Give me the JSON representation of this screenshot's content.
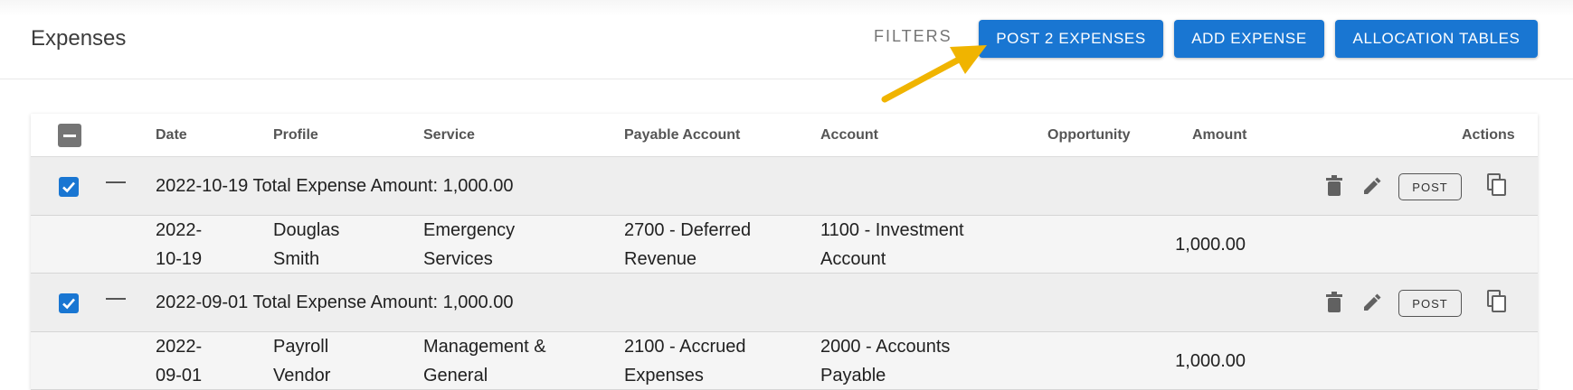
{
  "header": {
    "title": "Expenses",
    "filters_label": "FILTERS",
    "post_button": "POST 2 EXPENSES",
    "add_button": "ADD EXPENSE",
    "allocation_button": "ALLOCATION TABLES"
  },
  "table": {
    "columns": [
      "Date",
      "Profile",
      "Service",
      "Payable Account",
      "Account",
      "Opportunity",
      "Amount",
      "Actions"
    ],
    "groups": [
      {
        "summary": "2022-10-19 Total Expense Amount: 1,000.00",
        "checked": true,
        "post_label": "POST",
        "row": {
          "date_line1": "2022-",
          "date_line2": "10-19",
          "profile_line1": "Douglas",
          "profile_line2": "Smith",
          "service_line1": "Emergency",
          "service_line2": "Services",
          "payable_line1": "2700 - Deferred",
          "payable_line2": "Revenue",
          "account_line1": "1100 - Investment",
          "account_line2": "Account",
          "opportunity": "",
          "amount": "1,000.00"
        }
      },
      {
        "summary": "2022-09-01 Total Expense Amount: 1,000.00",
        "checked": true,
        "post_label": "POST",
        "row": {
          "date_line1": "2022-",
          "date_line2": "09-01",
          "profile_line1": "Payroll",
          "profile_line2": "Vendor",
          "service_line1": "Management &",
          "service_line2": "General",
          "payable_line1": "2100 - Accrued",
          "payable_line2": "Expenses",
          "account_line1": "2000 - Accounts",
          "account_line2": "Payable",
          "opportunity": "",
          "amount": "1,000.00"
        }
      }
    ]
  },
  "colors": {
    "primary": "#1976d2",
    "arrow": "#f0b400",
    "group_bg": "#eeeeee",
    "detail_bg": "#f5f5f5"
  },
  "icons": [
    "checkbox-indeterminate-icon",
    "checkbox-checked-icon",
    "collapse-icon",
    "trash-icon",
    "pencil-icon",
    "copy-icon",
    "annotation-arrow"
  ]
}
